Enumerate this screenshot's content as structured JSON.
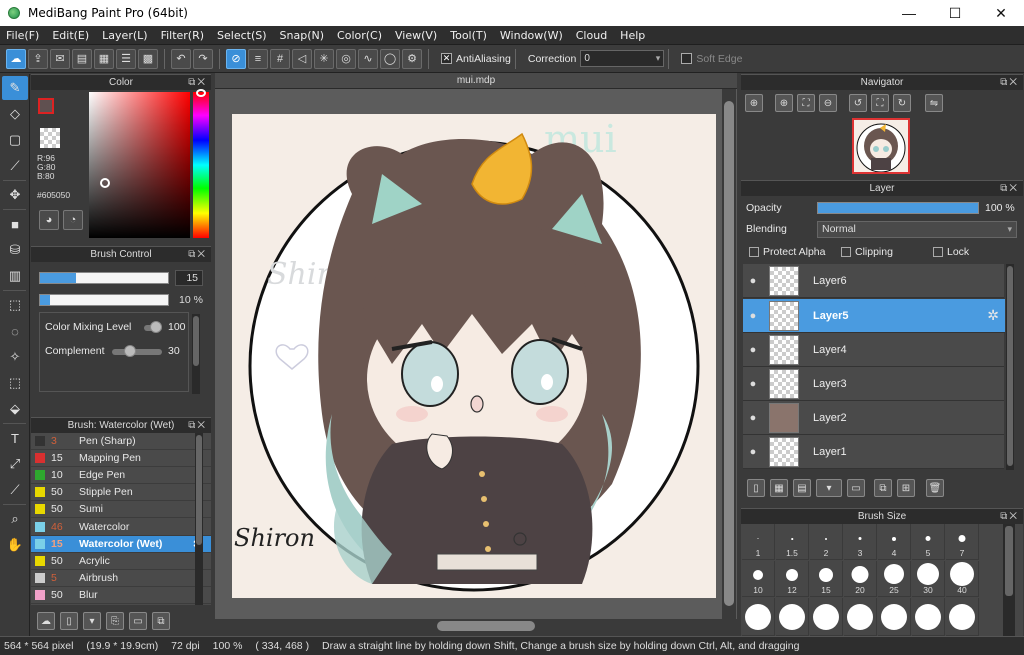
{
  "window": {
    "title": "MediBang Paint Pro (64bit)",
    "minimize": "—",
    "maximize": "☐",
    "close": "✕"
  },
  "menu": [
    "File(F)",
    "Edit(E)",
    "Layer(L)",
    "Filter(R)",
    "Select(S)",
    "Snap(N)",
    "Color(C)",
    "View(V)",
    "Tool(T)",
    "Window(W)",
    "Cloud",
    "Help"
  ],
  "toolbar": {
    "antialiasing_label": "AntiAliasing",
    "antialiasing_checked": "✕",
    "correction_label": "Correction",
    "correction_value": "0",
    "soft_edge_label": "Soft Edge"
  },
  "color_panel": {
    "title": "Color",
    "r": "R:96",
    "g": "G:80",
    "b": "B:80",
    "hex": "#605050",
    "foreground": "#605050"
  },
  "brush_control": {
    "title": "Brush Control",
    "size_value": "15",
    "size_fraction": 0.28,
    "opacity_value": "10 %",
    "opacity_fraction": 0.08,
    "color_mixing_label": "Color Mixing Level",
    "color_mixing_value": "100",
    "complement_label": "Complement",
    "complement_value": "30"
  },
  "brush_list": {
    "title": "Brush: Watercolor (Wet)",
    "items": [
      {
        "size": "3",
        "name": "Pen (Sharp)",
        "color": "#333333"
      },
      {
        "size": "15",
        "name": "Mapping Pen",
        "color": "#d93030"
      },
      {
        "size": "10",
        "name": "Edge Pen",
        "color": "#2ea82e"
      },
      {
        "size": "50",
        "name": "Stipple Pen",
        "color": "#e8d800"
      },
      {
        "size": "50",
        "name": "Sumi",
        "color": "#e8d800"
      },
      {
        "size": "46",
        "name": "Watercolor",
        "color": "#7ad0e8"
      },
      {
        "size": "15",
        "name": "Watercolor (Wet)",
        "color": "#7ad0e8",
        "selected": true
      },
      {
        "size": "50",
        "name": "Acrylic",
        "color": "#e8d800"
      },
      {
        "size": "5",
        "name": "Airbrush",
        "color": "#cccccc"
      },
      {
        "size": "50",
        "name": "Blur",
        "color": "#f0a0c8"
      }
    ]
  },
  "canvas": {
    "tab": "mui.mdp",
    "artwork_text_1": "mui",
    "artwork_text_2": "Shiron",
    "signature": "Shiron"
  },
  "navigator": {
    "title": "Navigator"
  },
  "layer_panel": {
    "title": "Layer",
    "opacity_label": "Opacity",
    "opacity_value": "100 %",
    "blending_label": "Blending",
    "blending_value": "Normal",
    "protect_alpha": "Protect Alpha",
    "clipping": "Clipping",
    "lock": "Lock",
    "layers": [
      {
        "name": "Layer6"
      },
      {
        "name": "Layer5",
        "selected": true
      },
      {
        "name": "Layer4"
      },
      {
        "name": "Layer3"
      },
      {
        "name": "Layer2"
      },
      {
        "name": "Layer1"
      }
    ]
  },
  "brush_size": {
    "title": "Brush Size",
    "row1": [
      "1",
      "1.5",
      "2",
      "3",
      "4",
      "5",
      "7"
    ],
    "row2": [
      "10",
      "12",
      "15",
      "20",
      "25",
      "30",
      "40"
    ]
  },
  "status": {
    "size": "564 * 564 pixel",
    "cm": "(19.9 * 19.9cm)",
    "dpi": "72 dpi",
    "zoom": "100 %",
    "coords": "( 334, 468 )",
    "hint": "Draw a straight line by holding down Shift, Change a brush size by holding down Ctrl, Alt, and dragging"
  }
}
